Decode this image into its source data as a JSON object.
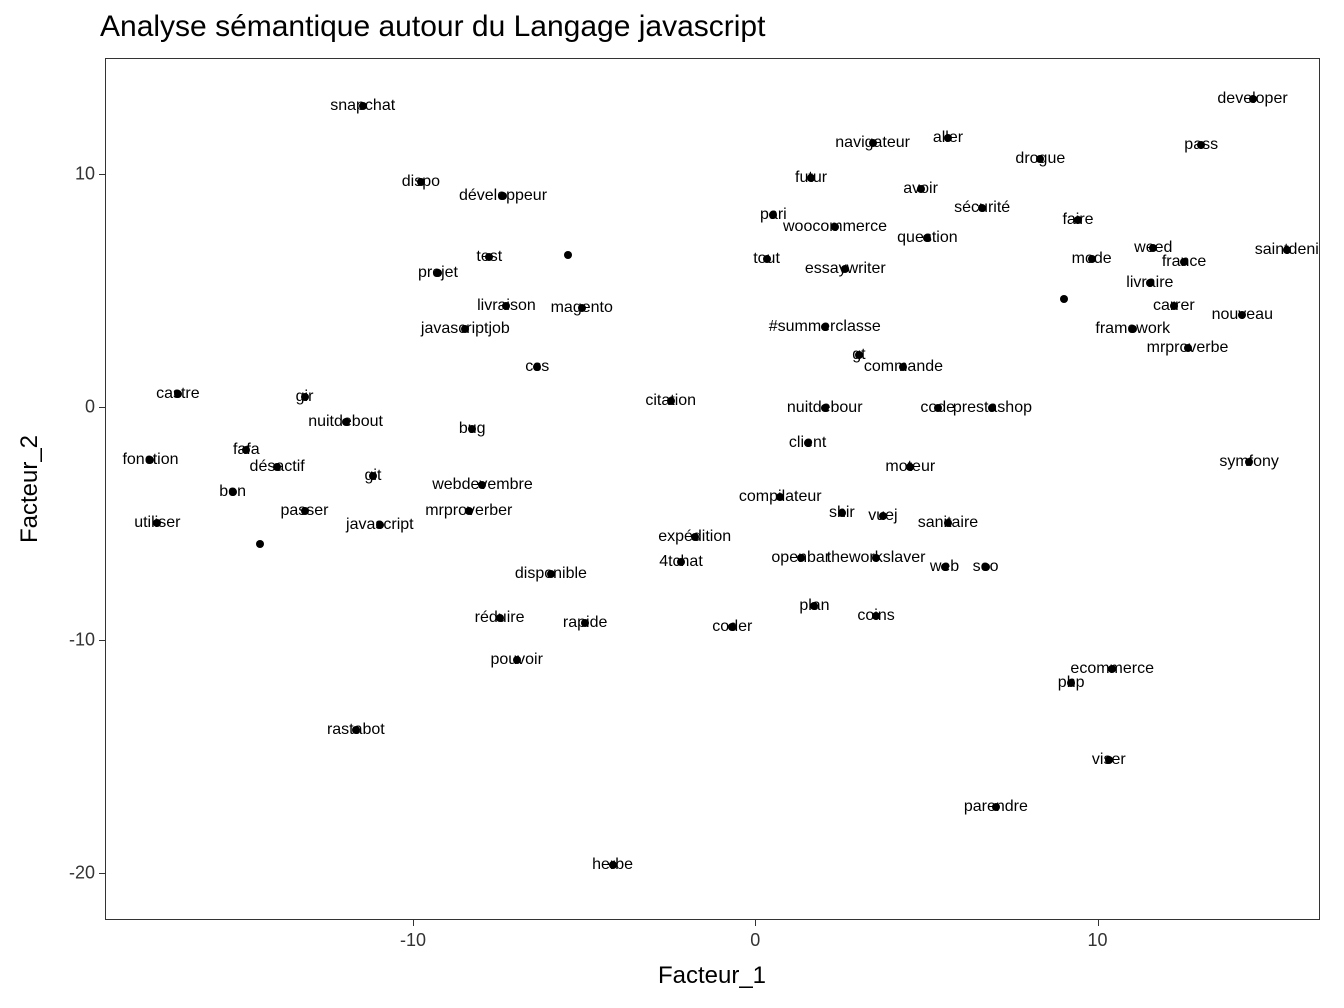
{
  "chart_data": {
    "type": "scatter",
    "title": "Analyse sémantique autour du Langage javascript",
    "xlabel": "Facteur_1",
    "ylabel": "Facteur_2",
    "xlim": [
      -19,
      16.5
    ],
    "ylim": [
      -22,
      15
    ],
    "xticks": [
      -10,
      0,
      10
    ],
    "yticks": [
      -20,
      -10,
      0,
      10
    ],
    "points": [
      {
        "label": "snapchat",
        "x": -11.5,
        "y": 13
      },
      {
        "label": "developer",
        "x": 14.5,
        "y": 13.3
      },
      {
        "label": "navigateur",
        "x": 3.4,
        "y": 11.4
      },
      {
        "label": "aller",
        "x": 5.6,
        "y": 11.6
      },
      {
        "label": "pass",
        "x": 13,
        "y": 11.3
      },
      {
        "label": "drogue",
        "x": 8.3,
        "y": 10.7
      },
      {
        "label": "futur",
        "x": 1.6,
        "y": 9.9
      },
      {
        "label": "dispo",
        "x": -9.8,
        "y": 9.7
      },
      {
        "label": "avoir",
        "x": 4.8,
        "y": 9.4
      },
      {
        "label": "développeur",
        "x": -7.4,
        "y": 9.1
      },
      {
        "label": "sécurité",
        "x": 6.6,
        "y": 8.6
      },
      {
        "label": "pari",
        "x": 0.5,
        "y": 8.3
      },
      {
        "label": "faire",
        "x": 9.4,
        "y": 8.1
      },
      {
        "label": "woocommerce",
        "x": 2.3,
        "y": 7.8
      },
      {
        "label": "question",
        "x": 5.0,
        "y": 7.3
      },
      {
        "label": "weed",
        "x": 11.6,
        "y": 6.9
      },
      {
        "label": "saintdeni",
        "x": 15.5,
        "y": 6.8
      },
      {
        "label": "test",
        "x": -7.8,
        "y": 6.5
      },
      {
        "label": "tout",
        "x": 0.3,
        "y": 6.4
      },
      {
        "label": "france",
        "x": 12.5,
        "y": 6.3
      },
      {
        "label": "mode",
        "x": 9.8,
        "y": 6.4
      },
      {
        "label": "essaywriter",
        "x": 2.6,
        "y": 6.0
      },
      {
        "label": "projet",
        "x": -9.3,
        "y": 5.8
      },
      {
        "label": "livraire",
        "x": 11.5,
        "y": 5.4
      },
      {
        "label": "carrer",
        "x": 12.2,
        "y": 4.4
      },
      {
        "label": "livraison",
        "x": -7.3,
        "y": 4.4
      },
      {
        "label": "magento",
        "x": -5.1,
        "y": 4.3
      },
      {
        "label": "nouveau",
        "x": 14.2,
        "y": 4.0
      },
      {
        "label": "#summerclasse",
        "x": 2.0,
        "y": 3.5
      },
      {
        "label": "framework",
        "x": 11.0,
        "y": 3.4
      },
      {
        "label": "javascriptjob",
        "x": -8.5,
        "y": 3.4
      },
      {
        "label": "mrproverbe",
        "x": 12.6,
        "y": 2.6
      },
      {
        "label": "gt",
        "x": 3.0,
        "y": 2.3
      },
      {
        "label": "css",
        "x": -6.4,
        "y": 1.8
      },
      {
        "label": "commande",
        "x": 4.3,
        "y": 1.8
      },
      {
        "label": "castre",
        "x": -16.9,
        "y": 0.6
      },
      {
        "label": "gir",
        "x": -13.2,
        "y": 0.5
      },
      {
        "label": "citation",
        "x": -2.5,
        "y": 0.3
      },
      {
        "label": "nuitdebour",
        "x": 2.0,
        "y": 0
      },
      {
        "label": "code",
        "x": 5.3,
        "y": 0
      },
      {
        "label": "prestashop",
        "x": 6.9,
        "y": 0.0
      },
      {
        "label": "nuitdebout",
        "x": -12.0,
        "y": -0.6
      },
      {
        "label": "bug",
        "x": -8.3,
        "y": -0.9
      },
      {
        "label": "client",
        "x": 1.5,
        "y": -1.5
      },
      {
        "label": "fafa",
        "x": -14.9,
        "y": -1.8
      },
      {
        "label": "fonction",
        "x": -17.7,
        "y": -2.2
      },
      {
        "label": "désactif",
        "x": -14.0,
        "y": -2.5
      },
      {
        "label": "symfony",
        "x": 14.4,
        "y": -2.3
      },
      {
        "label": "moteur",
        "x": 4.5,
        "y": -2.5
      },
      {
        "label": "git",
        "x": -11.2,
        "y": -2.9
      },
      {
        "label": "webdevembre",
        "x": -8.0,
        "y": -3.3
      },
      {
        "label": "bon",
        "x": -15.3,
        "y": -3.6
      },
      {
        "label": "compilateur",
        "x": 0.7,
        "y": -3.8
      },
      {
        "label": "passer",
        "x": -13.2,
        "y": -4.4
      },
      {
        "label": "mrproverber",
        "x": -8.4,
        "y": -4.4
      },
      {
        "label": "shir",
        "x": 2.5,
        "y": -4.5
      },
      {
        "label": "vuej",
        "x": 3.7,
        "y": -4.6
      },
      {
        "label": "utiliser",
        "x": -17.5,
        "y": -4.9
      },
      {
        "label": "sanitaire",
        "x": 5.6,
        "y": -4.9
      },
      {
        "label": "javascript",
        "x": -11.0,
        "y": -5.0
      },
      {
        "label": "expédition",
        "x": -1.8,
        "y": -5.5
      },
      {
        "label": "openbar",
        "x": 1.3,
        "y": -6.4
      },
      {
        "label": "theworkslaver",
        "x": 3.5,
        "y": -6.4
      },
      {
        "label": "4tchat",
        "x": -2.2,
        "y": -6.6
      },
      {
        "label": "web",
        "x": 5.5,
        "y": -6.8
      },
      {
        "label": "seo",
        "x": 6.7,
        "y": -6.8
      },
      {
        "label": "disponible",
        "x": -6.0,
        "y": -7.1
      },
      {
        "label": "plan",
        "x": 1.7,
        "y": -8.5
      },
      {
        "label": "coins",
        "x": 3.5,
        "y": -8.9
      },
      {
        "label": "réduire",
        "x": -7.5,
        "y": -9.0
      },
      {
        "label": "rapide",
        "x": -5.0,
        "y": -9.2
      },
      {
        "label": "coder",
        "x": -0.7,
        "y": -9.4
      },
      {
        "label": "pouvoir",
        "x": -7.0,
        "y": -10.8
      },
      {
        "label": "ecommerce",
        "x": 10.4,
        "y": -11.2
      },
      {
        "label": "php",
        "x": 9.2,
        "y": -11.8
      },
      {
        "label": "rastabot",
        "x": -11.7,
        "y": -13.8
      },
      {
        "label": "viser",
        "x": 10.3,
        "y": -15.1
      },
      {
        "label": "parendre",
        "x": 7.0,
        "y": -17.1
      },
      {
        "label": "herbe",
        "x": -4.2,
        "y": -19.6
      }
    ],
    "extra_points_no_label": [
      {
        "x": -5.5,
        "y": 6.6
      },
      {
        "x": -14.5,
        "y": -5.8
      },
      {
        "x": 9.0,
        "y": 4.7
      }
    ]
  }
}
